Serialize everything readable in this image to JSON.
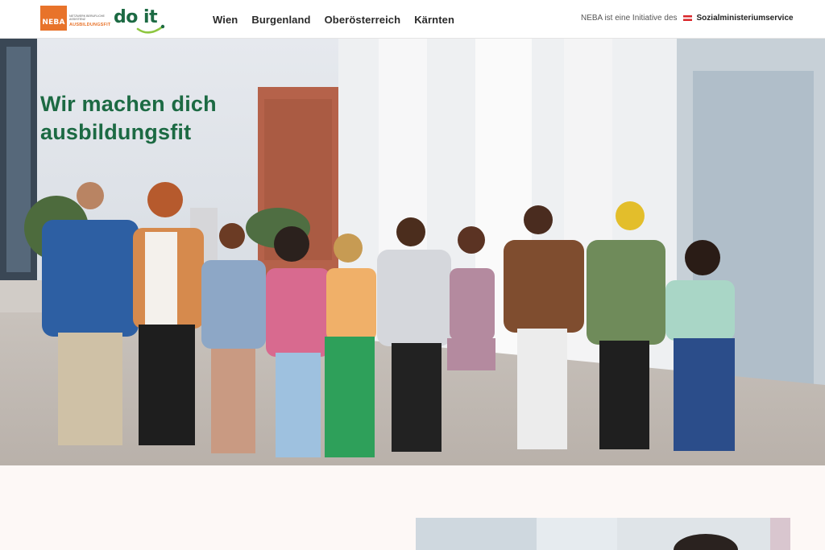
{
  "header": {
    "neba_logo_text": "NEBA",
    "neba_subtitle": "Netzwerk Berufliche Assistenz",
    "neba_fit": "AUSBILDUNGSFIT",
    "doit_logo_text": "do it"
  },
  "nav": {
    "items": [
      "Wien",
      "Burgenland",
      "Oberösterreich",
      "Kärnten"
    ]
  },
  "initiative": {
    "text": "NEBA ist eine Initiative des",
    "ministry": "Sozialministeriumservice"
  },
  "hero": {
    "title_line1": "Wir machen dich",
    "title_line2": "ausbildungsfit"
  },
  "colors": {
    "brand_green": "#1c6a43",
    "neba_orange": "#e8732a",
    "austria_red": "#d9262a",
    "page_background": "#fdf8f6"
  },
  "icons": [
    "neba-logo",
    "doit-logo",
    "austria-flag-icon"
  ]
}
